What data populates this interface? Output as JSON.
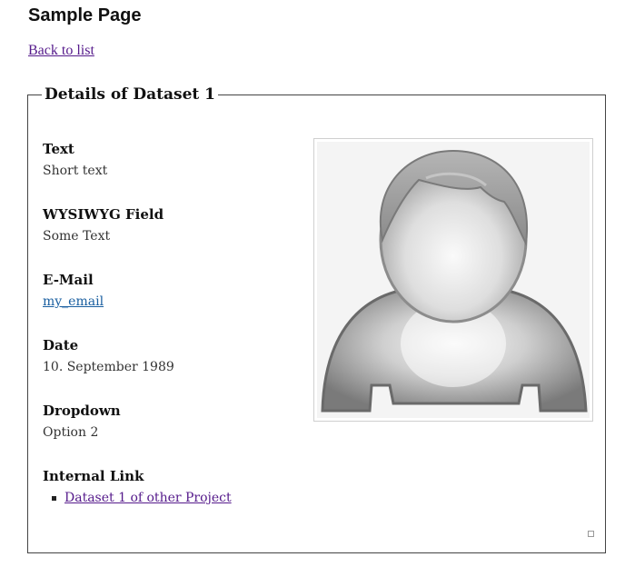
{
  "page": {
    "title": "Sample Page",
    "back_link": "Back to list"
  },
  "details": {
    "legend": "Details of Dataset 1",
    "fields": [
      {
        "label": "Text",
        "value": "Short text"
      },
      {
        "label": "WYSIWYG Field",
        "value": "Some Text"
      },
      {
        "label": "E-Mail",
        "value": "my_email"
      },
      {
        "label": "Date",
        "value": "10. September 1989"
      },
      {
        "label": "Dropdown",
        "value": "Option 2"
      },
      {
        "label": "Internal Link",
        "links": [
          "Dataset 1 of other Project"
        ]
      }
    ],
    "image": {
      "icon": "user-avatar-icon"
    }
  }
}
